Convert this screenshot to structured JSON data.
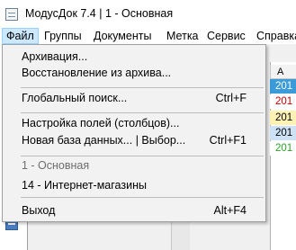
{
  "window": {
    "title": "МодусДок 7.4 | 1 - Основная"
  },
  "menubar": {
    "items": [
      {
        "label": "Файл"
      },
      {
        "label": "Группы"
      },
      {
        "label": "Документы"
      },
      {
        "label": "Метка"
      },
      {
        "label": "Сервис"
      },
      {
        "label": "Справка"
      }
    ]
  },
  "file_menu": {
    "archive": "Архивация...",
    "restore": "Восстановление из архива...",
    "global_search": "Глобальный поиск...",
    "global_search_shortcut": "Ctrl+F",
    "columns": "Настройка полей (столбцов)...",
    "new_db": "Новая база данных... | Выбор...",
    "new_db_shortcut": "Ctrl+F1",
    "db_current": "1 - Основная",
    "db_shops": "14 - Интернет-магазины",
    "exit": "Выход",
    "exit_shortcut": "Alt+F4"
  },
  "grid": {
    "header": "A",
    "rows": [
      {
        "text": "201",
        "bg": "#3b9bd8",
        "color": "#ffffff"
      },
      {
        "text": "201",
        "bg": "#ffffff",
        "color": "#c00000"
      },
      {
        "text": "201",
        "bg": "#fff2b3",
        "color": "#000000"
      },
      {
        "text": "201",
        "bg": "#cde3f5",
        "color": "#000000"
      },
      {
        "text": "201",
        "bg": "#ffffff",
        "color": "#2ca02c"
      }
    ]
  }
}
